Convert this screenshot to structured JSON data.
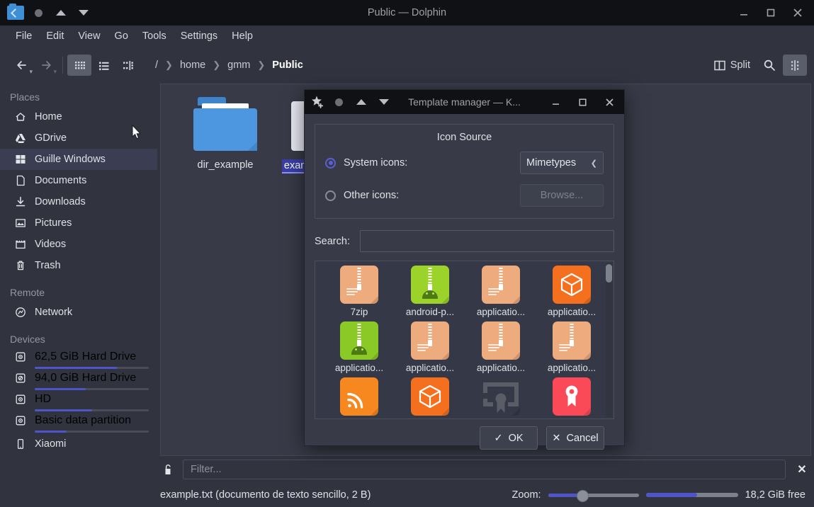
{
  "window": {
    "title": "Public — Dolphin",
    "titlebar_icons": [
      "folder-icon",
      "record-dot-icon",
      "triangle-up-icon",
      "triangle-down-icon"
    ],
    "controls": {
      "minimize": "minimize-icon",
      "maximize": "maximize-icon",
      "close": "close-icon"
    }
  },
  "menubar": {
    "items": [
      "File",
      "Edit",
      "View",
      "Go",
      "Tools",
      "Settings",
      "Help"
    ]
  },
  "toolbar": {
    "back": "back-icon",
    "forward": "forward-icon",
    "view_modes": [
      "icons-view",
      "details-view",
      "compact-view"
    ],
    "selected_view": "icons-view",
    "split_label": "Split",
    "search": "search-icon",
    "control": "control-icon"
  },
  "breadcrumb": {
    "items": [
      "/",
      "home",
      "gmm",
      "Public"
    ],
    "active_index": 3
  },
  "sidebar": {
    "sections": [
      {
        "title": "Places",
        "items": [
          {
            "label": "Home",
            "icon": "home-icon",
            "active": false
          },
          {
            "label": "GDrive",
            "icon": "gdrive-icon",
            "active": false
          },
          {
            "label": "Guille Windows",
            "icon": "windows-icon",
            "active": true
          },
          {
            "label": "Documents",
            "icon": "document-icon",
            "active": false
          },
          {
            "label": "Downloads",
            "icon": "download-icon",
            "active": false
          },
          {
            "label": "Pictures",
            "icon": "picture-icon",
            "active": false
          },
          {
            "label": "Videos",
            "icon": "video-icon",
            "active": false
          },
          {
            "label": "Trash",
            "icon": "trash-icon",
            "active": false
          }
        ]
      },
      {
        "title": "Remote",
        "items": [
          {
            "label": "Network",
            "icon": "network-icon",
            "active": false
          }
        ]
      },
      {
        "title": "Devices",
        "items": [
          {
            "label": "62,5 GiB Hard Drive",
            "icon": "disk-icon",
            "usage_pct": 72
          },
          {
            "label": "94,0 GiB Hard Drive",
            "icon": "disk-locked-icon",
            "usage_pct": 45
          },
          {
            "label": "HD",
            "icon": "disk-icon",
            "usage_pct": 50
          },
          {
            "label": "Basic data partition",
            "icon": "disk-icon",
            "usage_pct": 28
          },
          {
            "label": "Xiaomi",
            "icon": "phone-icon",
            "usage_pct": null
          }
        ]
      }
    ]
  },
  "content": {
    "files": [
      {
        "name": "dir_example",
        "type": "folder",
        "selected": false
      },
      {
        "name": "example.txt",
        "type": "file",
        "selected": true
      }
    ]
  },
  "filterbar": {
    "lock_icon": "unlocked-icon",
    "placeholder": "Filter...",
    "close": "close-icon"
  },
  "statusbar": {
    "info": "example.txt (documento de texto sencillo, 2 B)",
    "zoom_label": "Zoom:",
    "zoom_value": 30,
    "capacity_pct": 55,
    "free_space": "18,2 GiB free"
  },
  "dialog": {
    "title": "Template manager — K...",
    "titlebar_icons": [
      "star-add-icon",
      "record-dot-icon",
      "triangle-up-icon",
      "triangle-down-icon"
    ],
    "controls": {
      "minimize": "minimize-icon",
      "maximize": "maximize-icon",
      "close": "close-icon"
    },
    "group": {
      "title": "Icon Source",
      "system_icons_label": "System icons:",
      "system_icons_selected": true,
      "combo_value": "Mimetypes",
      "other_icons_label": "Other icons:",
      "other_icons_selected": false,
      "browse_label": "Browse..."
    },
    "search_label": "Search:",
    "search_value": "",
    "icons": [
      {
        "name": "7zip",
        "tile": "zip",
        "color": "#eeab7d"
      },
      {
        "name": "android-p...",
        "tile": "zip-droid",
        "color": "#9bd32b"
      },
      {
        "name": "applicatio...",
        "tile": "zip",
        "color": "#eeab7d"
      },
      {
        "name": "applicatio...",
        "tile": "cube",
        "color": "#f4701f"
      },
      {
        "name": "applicatio...",
        "tile": "zip-droid",
        "color": "#8bc926"
      },
      {
        "name": "applicatio...",
        "tile": "zip",
        "color": "#eeab7d"
      },
      {
        "name": "applicatio...",
        "tile": "zip",
        "color": "#eeab7d"
      },
      {
        "name": "applicatio...",
        "tile": "zip",
        "color": "#eeab7d"
      },
      {
        "name": "",
        "tile": "rss",
        "color": "#f7871f"
      },
      {
        "name": "",
        "tile": "cube",
        "color": "#f4701f"
      },
      {
        "name": "",
        "tile": "certificate-gray",
        "color": "#5a5d66"
      },
      {
        "name": "",
        "tile": "certificate",
        "color": "#fa4a57"
      }
    ],
    "ok_label": "OK",
    "cancel_label": "Cancel"
  },
  "colors": {
    "accent": "#4f55c7",
    "window_bg": "#31343f",
    "titlebar_bg": "#101114",
    "selection": "#3b3ea8"
  }
}
